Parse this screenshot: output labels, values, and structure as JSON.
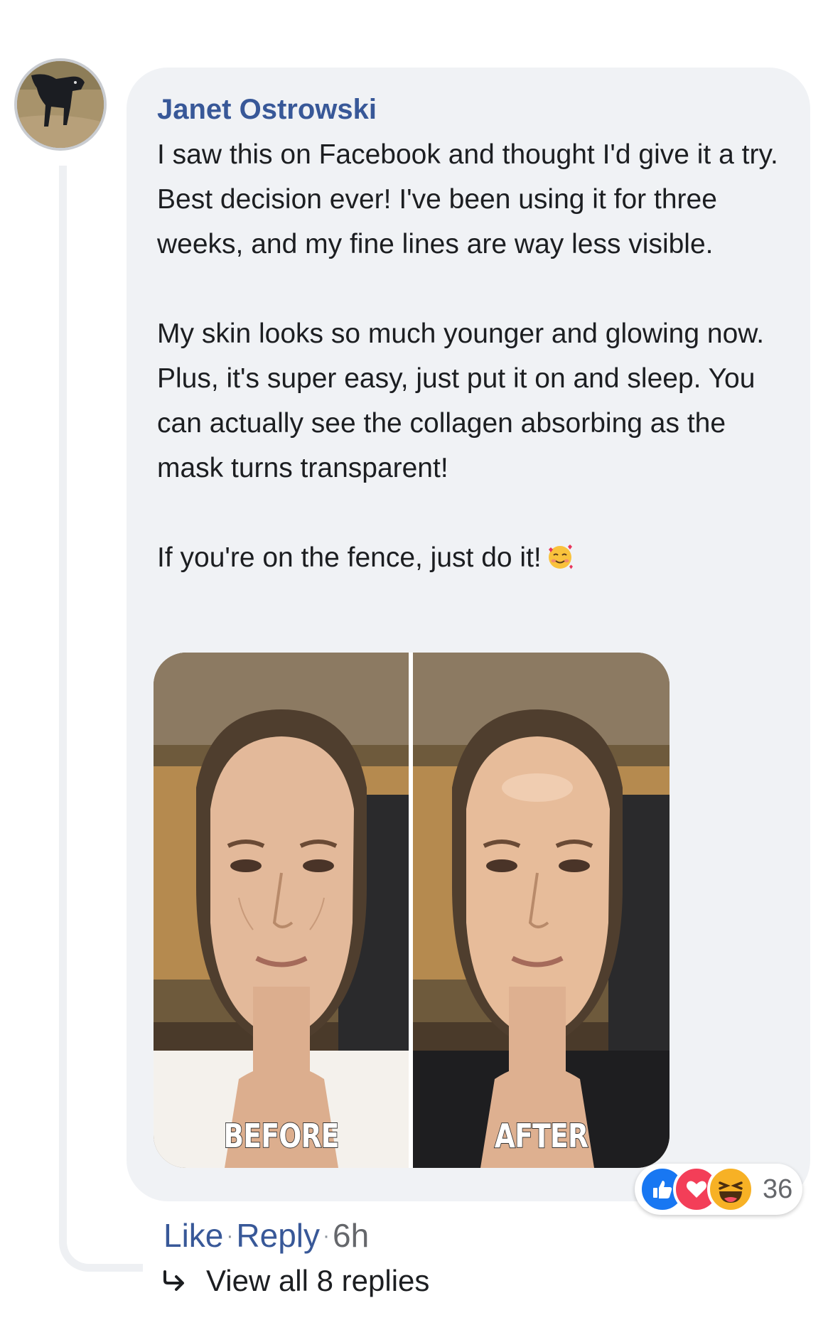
{
  "comment": {
    "author": "Janet Ostrowski",
    "paragraphs": [
      "I saw this on Facebook and thought I'd give it a try. Best decision ever! I've been using it for three weeks, and my fine lines are way less visible.",
      "My skin looks so much younger and glowing now. Plus, it's super easy, just put it on and sleep. You can actually see the collagen absorbing as the mask turns transparent!",
      "If you're on the fence, just do it!"
    ],
    "emoji_icon": "smiling-face-with-hearts-icon",
    "image": {
      "before_label": "BEFORE",
      "after_label": "AFTER"
    }
  },
  "reactions": {
    "icons": [
      "like-icon",
      "love-icon",
      "haha-icon"
    ],
    "count": "36",
    "colors": {
      "like": "#1877f2",
      "love": "#f33e58",
      "haha": "#f7b125"
    }
  },
  "actions": {
    "like": "Like",
    "reply": "Reply",
    "separator": "·",
    "time": "6h"
  },
  "replies": {
    "label": "View all 8 replies"
  },
  "colors": {
    "author": "#385898",
    "bubble": "#f0f2f5",
    "link": "#385898",
    "text": "#1c1e21"
  }
}
